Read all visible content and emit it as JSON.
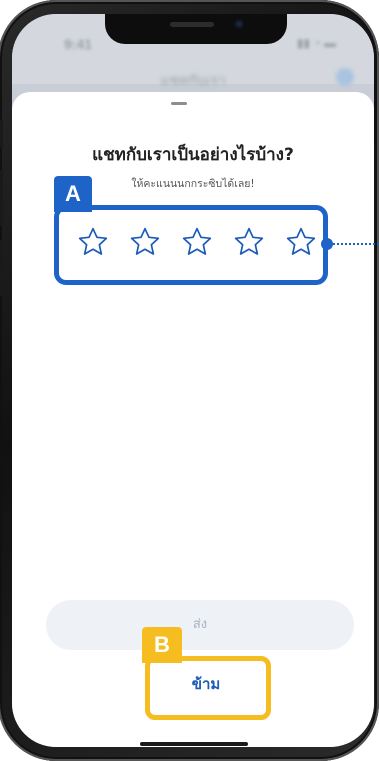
{
  "background_app": {
    "status_time": "9:41",
    "status_icons": "▮▮ ◔ ▬",
    "title": "แชทกับเรา"
  },
  "rating_sheet": {
    "title": "แชทกับเราเป็นอย่างไรบ้าง?",
    "subtitle": "ให้คะแนนนกกระซิบได้เลย!",
    "star_count": 5,
    "selected_rating": 0,
    "send_label": "ส่ง",
    "skip_label": "ข้าม"
  },
  "annotations": {
    "a_label": "A",
    "b_label": "B",
    "a_color": "#1e64c8",
    "b_color": "#f5bd1f"
  },
  "colors": {
    "star_outline": "#1a5bb7",
    "skip_text": "#1a5bb7",
    "send_bg_disabled": "#eef2f7",
    "send_text_disabled": "#a7b1bd"
  },
  "icons": {
    "star": "star-outline-icon"
  }
}
